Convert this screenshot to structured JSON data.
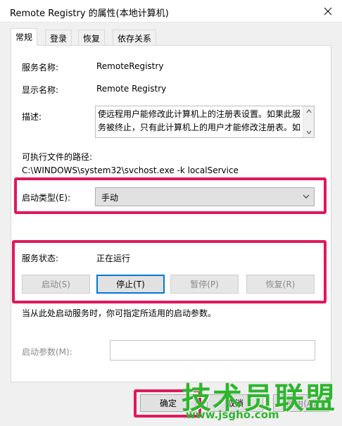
{
  "window": {
    "title": "Remote Registry 的属性(本地计算机)"
  },
  "tabs": [
    {
      "label": "常规"
    },
    {
      "label": "登录"
    },
    {
      "label": "恢复"
    },
    {
      "label": "依存关系"
    }
  ],
  "general": {
    "service_name_label": "服务名称:",
    "service_name_value": "RemoteRegistry",
    "display_name_label": "显示名称:",
    "display_name_value": "Remote Registry",
    "description_label": "描述:",
    "description_value": "使远程用户能修改此计算机上的注册表设置。如果此服务被终止，只有此计算机上的用户才能修改注册表。如",
    "path_label": "可执行文件的路径:",
    "path_value": "C:\\WINDOWS\\system32\\svchost.exe -k localService",
    "startup_type_label": "启动类型(E):",
    "startup_type_value": "手动",
    "status_label": "服务状态:",
    "status_value": "正在运行",
    "buttons": {
      "start": "启动(S)",
      "stop": "停止(T)",
      "pause": "暂停(P)",
      "resume": "恢复(R)"
    },
    "hint": "当从此处启动服务时，你可指定所适用的启动参数。",
    "param_label": "启动参数(M):",
    "param_value": ""
  },
  "footer": {
    "ok": "确定",
    "cancel": "取消",
    "apply": "应用(A)"
  },
  "watermark": {
    "text": "技术员联盟",
    "url": "www.jsgho.com"
  },
  "colors": {
    "highlight_box": "#e0185e",
    "focus_border": "#0078d7",
    "watermark": "#2fb52f"
  }
}
